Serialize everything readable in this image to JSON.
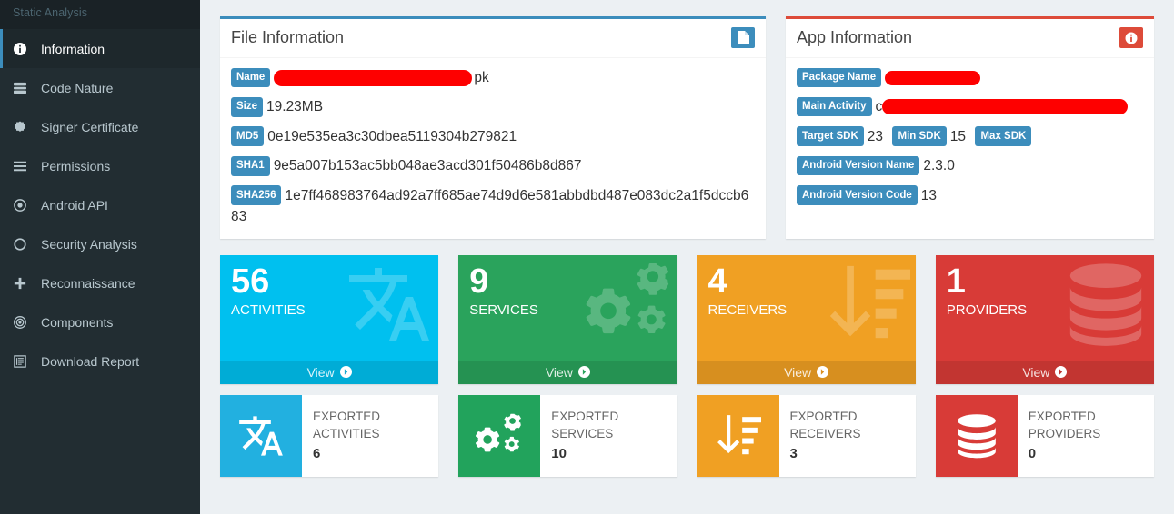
{
  "sidebar": {
    "header": "Static Analysis",
    "items": [
      {
        "label": "Information",
        "icon": "info-circle-icon",
        "active": true
      },
      {
        "label": "Code Nature",
        "icon": "server-icon",
        "active": false
      },
      {
        "label": "Signer Certificate",
        "icon": "certificate-icon",
        "active": false
      },
      {
        "label": "Permissions",
        "icon": "bars-icon",
        "active": false
      },
      {
        "label": "Android API",
        "icon": "dot-circle-icon",
        "active": false
      },
      {
        "label": "Security Analysis",
        "icon": "circle-o-icon",
        "active": false
      },
      {
        "label": "Reconnaissance",
        "icon": "plus-icon",
        "active": false
      },
      {
        "label": "Components",
        "icon": "bullseye-icon",
        "active": false
      },
      {
        "label": "Download Report",
        "icon": "book-icon",
        "active": false
      }
    ]
  },
  "file_information": {
    "title": "File Information",
    "header_icon": "file-icon",
    "accent": "#3c8dbc",
    "rows": [
      {
        "tag": "Name",
        "value": "pk",
        "redacted": true
      },
      {
        "tag": "Size",
        "value": "19.23MB",
        "redacted": false
      },
      {
        "tag": "MD5",
        "value": "0e19e535ea3c30dbea5119304b279821",
        "redacted": false
      },
      {
        "tag": "SHA1",
        "value": "9e5a007b153ac5bb048ae3acd301f50486b8d867",
        "redacted": false
      },
      {
        "tag": "SHA256",
        "value": "1e7ff468983764ad92a7ff685ae74d9d6e581abbdbd487e083dc2a1f5dccb683",
        "redacted": false
      }
    ]
  },
  "app_information": {
    "title": "App Information",
    "header_icon": "info-circle-icon",
    "accent": "#dd4b39",
    "rows": [
      {
        "tag": "Package Name",
        "value": "",
        "redacted": true
      },
      {
        "tag": "Main Activity",
        "value": "c",
        "redacted": true
      },
      {
        "tag": "Target SDK",
        "value": "23",
        "redacted": false
      },
      {
        "tag": "Min SDK",
        "value": "15",
        "redacted": false
      },
      {
        "tag": "Max SDK",
        "value": "",
        "redacted": false
      },
      {
        "tag": "Android Version Name",
        "value": "2.3.0",
        "redacted": false
      },
      {
        "tag": "Android Version Code",
        "value": "13",
        "redacted": false
      }
    ]
  },
  "tiles": [
    {
      "number": "56",
      "label": "ACTIVITIES",
      "view": "View",
      "color": "#00c0ef",
      "icon": "translate-icon"
    },
    {
      "number": "9",
      "label": "SERVICES",
      "view": "View",
      "color": "#2aa35c",
      "icon": "gears-icon"
    },
    {
      "number": "4",
      "label": "RECEIVERS",
      "view": "View",
      "color": "#f0a023",
      "icon": "sort-amount-desc-icon"
    },
    {
      "number": "1",
      "label": "PROVIDERS",
      "view": "View",
      "color": "#d83b37",
      "icon": "database-icon"
    }
  ],
  "exports": [
    {
      "line1": "EXPORTED",
      "line2": "ACTIVITIES",
      "value": "6",
      "color": "#22b0e0",
      "icon": "translate-icon"
    },
    {
      "line1": "EXPORTED",
      "line2": "SERVICES",
      "value": "10",
      "color": "#22a35c",
      "icon": "gears-icon"
    },
    {
      "line1": "EXPORTED",
      "line2": "RECEIVERS",
      "value": "3",
      "color": "#f0a023",
      "icon": "sort-amount-desc-icon"
    },
    {
      "line1": "EXPORTED",
      "line2": "PROVIDERS",
      "value": "0",
      "color": "#d83b37",
      "icon": "database-icon"
    }
  ]
}
